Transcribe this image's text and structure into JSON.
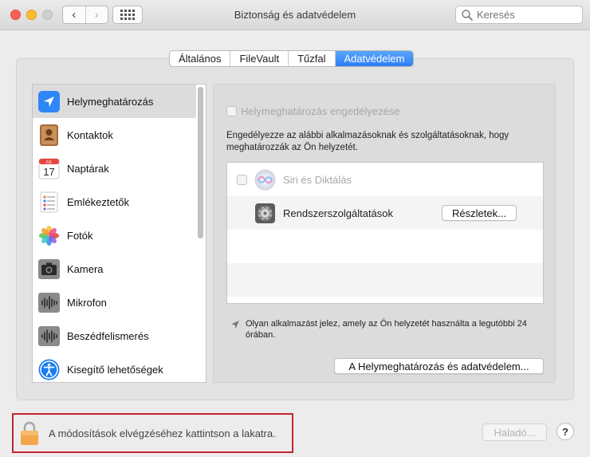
{
  "window": {
    "title": "Biztonság és adatvédelem",
    "nav_back": "‹",
    "nav_forward": "›"
  },
  "search": {
    "placeholder": "Keresés"
  },
  "tabs": [
    {
      "label": "Általános",
      "active": false
    },
    {
      "label": "FileVault",
      "active": false
    },
    {
      "label": "Tűzfal",
      "active": false
    },
    {
      "label": "Adatvédelem",
      "active": true
    }
  ],
  "sidebar": {
    "items": [
      {
        "label": "Helymeghatározás",
        "icon": "location-arrow-icon",
        "selected": true
      },
      {
        "label": "Kontaktok",
        "icon": "contacts-icon",
        "selected": false
      },
      {
        "label": "Naptárak",
        "icon": "calendar-icon",
        "selected": false,
        "icon_month": "JUL",
        "icon_day": "17"
      },
      {
        "label": "Emlékeztetők",
        "icon": "reminders-icon",
        "selected": false
      },
      {
        "label": "Fotók",
        "icon": "photos-icon",
        "selected": false
      },
      {
        "label": "Kamera",
        "icon": "camera-icon",
        "selected": false
      },
      {
        "label": "Mikrofon",
        "icon": "microphone-icon",
        "selected": false
      },
      {
        "label": "Beszédfelismerés",
        "icon": "speech-recognition-icon",
        "selected": false
      },
      {
        "label": "Kisegítő lehetőségek",
        "icon": "accessibility-icon",
        "selected": false
      }
    ]
  },
  "location": {
    "enable_label": "Helymeghatározás engedélyezése",
    "description": "Engedélyezze az alábbi alkalmazásoknak és szolgáltatásoknak, hogy meghatározzák az Ön helyzetét.",
    "apps": [
      {
        "label": "Siri és Diktálás",
        "icon": "siri-icon",
        "has_checkbox": true,
        "enabled": false
      },
      {
        "label": "Rendszerszolgáltatások",
        "icon": "system-services-gear-icon",
        "has_checkbox": false,
        "enabled": true,
        "button": "Részletek..."
      }
    ],
    "hint": "Olyan alkalmazást jelez, amely az Ön helyzetét használta a legutóbbi 24 órában.",
    "about_button": "A Helymeghatározás és adatvédelem..."
  },
  "footer": {
    "lock_text": "A módosítások elvégzéséhez kattintson a lakatra.",
    "advanced_button": "Haladó...",
    "help_button": "?"
  },
  "colors": {
    "accent": "#2d7ef5",
    "highlight_border": "#c0272d"
  }
}
